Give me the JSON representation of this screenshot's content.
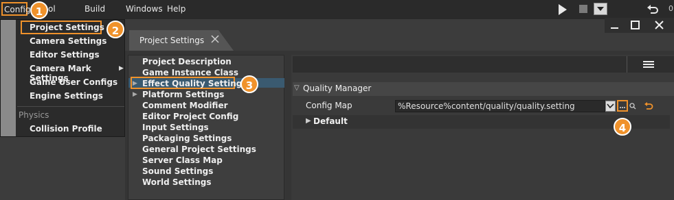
{
  "menubar": {
    "items": [
      "Config",
      "ol",
      "Build",
      "Windows",
      "Help"
    ]
  },
  "time_label": "0",
  "config_menu": {
    "items": [
      "Project Settings",
      "Camera Settings",
      "Editor Settings",
      "Camera Mark Settings",
      "Game User Configs",
      "Engine Settings"
    ],
    "section_label": "Physics",
    "section_items": [
      "Collision Profile"
    ]
  },
  "window": {
    "tab_label": "Project Settings"
  },
  "settings_list": {
    "items": [
      "Project Description",
      "Game Instance Class",
      "Effect Quality Settings",
      "Platform Settings",
      "Comment Modifier",
      "Editor Project Config",
      "Input Settings",
      "Packaging Settings",
      "General Project Settings",
      "Server Class Map",
      "Sound Settings",
      "World Settings"
    ]
  },
  "details": {
    "section_title": "Quality Manager",
    "config_map_label": "Config Map",
    "config_map_value": "%Resource%content/quality/quality.setting",
    "default_label": "Default"
  },
  "callouts": [
    "1",
    "2",
    "3",
    "4"
  ],
  "colors": {
    "accent": "#f0922b",
    "selection": "#3a5a70"
  }
}
